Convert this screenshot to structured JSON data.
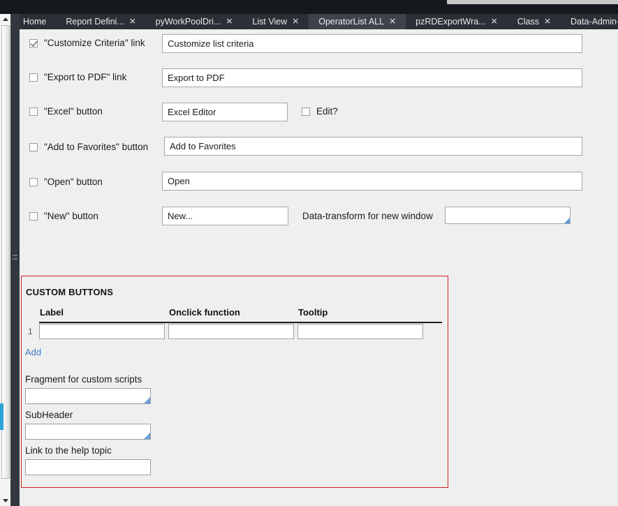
{
  "window": {
    "background_dark": "#2b2f36",
    "content_background": "#efefef",
    "accent_color": "#2ba3d4",
    "panel_border_color": "#cc1f1f",
    "link_color": "#3b7bbf"
  },
  "tabbar": {
    "tabs": [
      {
        "label": "Home",
        "closable": false,
        "active": false
      },
      {
        "label": "Report Defini...",
        "closable": true,
        "active": false,
        "close_icon": "close-icon"
      },
      {
        "label": "pyWorkPoolDri...",
        "closable": true,
        "active": false,
        "close_icon": "close-icon"
      },
      {
        "label": "List View",
        "closable": true,
        "active": false,
        "close_icon": "close-icon"
      },
      {
        "label": "OperatorList ALL",
        "closable": true,
        "active": true,
        "close_icon": "close-icon"
      },
      {
        "label": "pzRDExportWra...",
        "closable": true,
        "active": false,
        "close_icon": "close-icon"
      },
      {
        "label": "Class",
        "closable": true,
        "active": false,
        "close_icon": "close-icon"
      },
      {
        "label": "Data-Admin-Op...",
        "closable": false,
        "active": false
      }
    ]
  },
  "scrollbar": {
    "up_arrow": "scroll-up-arrow-icon",
    "down_arrow": "scroll-down-arrow-icon"
  },
  "form": {
    "rows": [
      {
        "checkbox_label": "\"Customize Criteria\" link",
        "checked": true,
        "value": "Customize list criteria",
        "placeholder": ""
      },
      {
        "checkbox_label": "\"Export to PDF\" link",
        "checked": false,
        "value": "Export to PDF",
        "placeholder": ""
      },
      {
        "checkbox_label": "\"Excel\" button",
        "checked": false,
        "value": "Excel Editor",
        "placeholder": "",
        "extra_checkbox_label": "Edit?",
        "extra_checked": false
      },
      {
        "checkbox_label": "\"Add to Favorites\" button",
        "checked": false,
        "value": "Add to Favorites",
        "placeholder": ""
      },
      {
        "checkbox_label": "\"Open\" button",
        "checked": false,
        "value": "Open",
        "placeholder": ""
      },
      {
        "checkbox_label": "\"New\" button",
        "checked": false,
        "value": "New...",
        "placeholder": "",
        "extra_text_label": "Data-transform for new window",
        "extra_value": ""
      }
    ]
  },
  "custom_buttons_panel": {
    "title": "CUSTOM BUTTONS",
    "columns": [
      "Label",
      "Onclick function",
      "Tooltip"
    ],
    "rows": [
      {
        "number": "1",
        "label": "",
        "onclick_function": "",
        "tooltip": ""
      }
    ],
    "add_link": "Add",
    "fields": [
      {
        "label": "Fragment for custom scripts",
        "value": "",
        "smart": true
      },
      {
        "label": "SubHeader",
        "value": "",
        "smart": true
      },
      {
        "label": "Link to the help topic",
        "value": "",
        "smart": false
      }
    ]
  }
}
